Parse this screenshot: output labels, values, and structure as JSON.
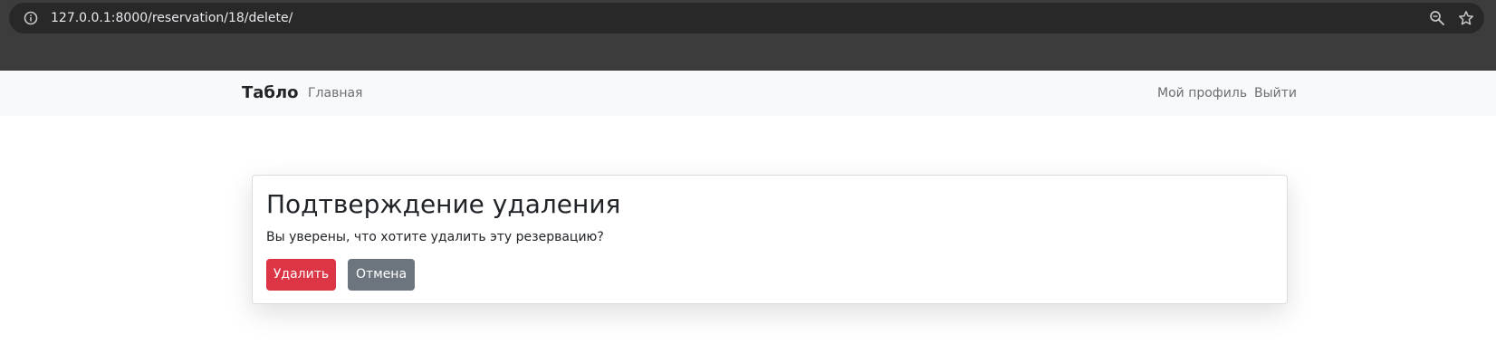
{
  "browser": {
    "url": "127.0.0.1:8000/reservation/18/delete/",
    "icons": {
      "site_info": "info-icon",
      "zoom": "zoom-icon",
      "bookmark": "star-icon"
    }
  },
  "navbar": {
    "brand": "Табло",
    "home": "Главная",
    "profile": "Мой профиль",
    "logout": "Выйти"
  },
  "card": {
    "title": "Подтверждение удаления",
    "message": "Вы уверены, что хотите удалить эту резервацию?",
    "delete_button": "Удалить",
    "cancel_button": "Отмена"
  },
  "colors": {
    "danger": "#dc3545",
    "secondary": "#6c757d",
    "navbar_bg": "#f8f9fa",
    "chrome_bg": "#3c3c3c"
  }
}
